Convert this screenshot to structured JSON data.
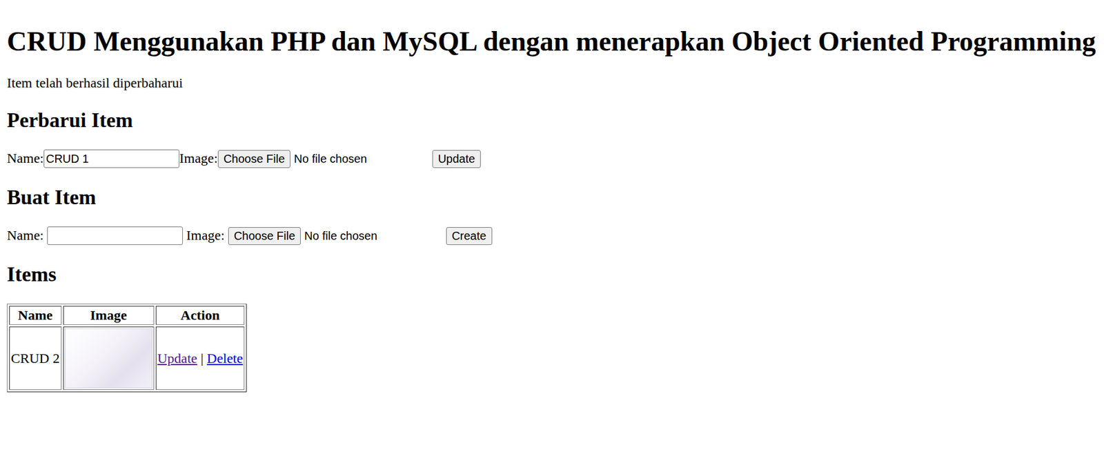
{
  "title": "CRUD Menggunakan PHP dan MySQL dengan menerapkan Object Oriented Programming",
  "message": "Item telah berhasil diperbaharui",
  "update_form": {
    "heading": "Perbarui Item",
    "name_label": "Name:",
    "name_value": "CRUD 1",
    "image_label": "Image:",
    "file_button": "Choose File",
    "file_status": "No file chosen",
    "submit": "Update"
  },
  "create_form": {
    "heading": "Buat Item",
    "name_label": "Name:",
    "name_value": "",
    "image_label": "Image:",
    "file_button": "Choose File",
    "file_status": "No file chosen",
    "submit": "Create"
  },
  "items": {
    "heading": "Items",
    "columns": [
      "Name",
      "Image",
      "Action"
    ],
    "rows": [
      {
        "name": "CRUD 2",
        "separator": "|",
        "actions": [
          {
            "label": "Update",
            "visited": true
          },
          {
            "label": "Delete",
            "visited": false
          }
        ]
      }
    ]
  }
}
